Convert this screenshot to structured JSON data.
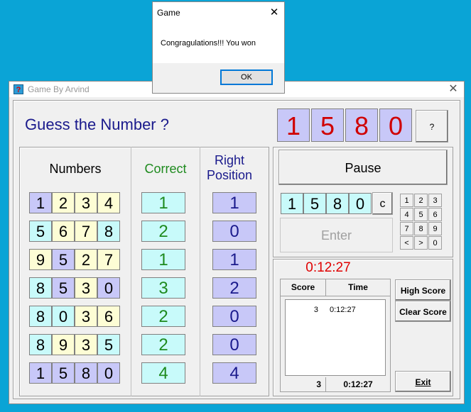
{
  "window": {
    "title": "Game By Arvind",
    "icon_text": "?",
    "close": "✕"
  },
  "game": {
    "heading": "Guess the Number ?",
    "answer_digits": [
      "1",
      "5",
      "8",
      "0"
    ],
    "help_label": "?",
    "columns": {
      "numbers": "Numbers",
      "correct": "Correct",
      "right_position_line1": "Right",
      "right_position_line2": "Position"
    },
    "guesses": [
      {
        "digits": [
          "1",
          "2",
          "3",
          "4"
        ],
        "colors": [
          "purple",
          "yellow",
          "yellow",
          "yellow"
        ],
        "correct": "1",
        "position": "1"
      },
      {
        "digits": [
          "5",
          "6",
          "7",
          "8"
        ],
        "colors": [
          "cyan",
          "yellow",
          "yellow",
          "cyan"
        ],
        "correct": "2",
        "position": "0"
      },
      {
        "digits": [
          "9",
          "5",
          "2",
          "7"
        ],
        "colors": [
          "yellow",
          "purple",
          "yellow",
          "yellow"
        ],
        "correct": "1",
        "position": "1"
      },
      {
        "digits": [
          "8",
          "5",
          "3",
          "0"
        ],
        "colors": [
          "cyan",
          "purple",
          "yellow",
          "purple"
        ],
        "correct": "3",
        "position": "2"
      },
      {
        "digits": [
          "8",
          "0",
          "3",
          "6"
        ],
        "colors": [
          "cyan",
          "cyan",
          "yellow",
          "yellow"
        ],
        "correct": "2",
        "position": "0"
      },
      {
        "digits": [
          "8",
          "9",
          "3",
          "5"
        ],
        "colors": [
          "cyan",
          "yellow",
          "yellow",
          "cyan"
        ],
        "correct": "2",
        "position": "0"
      },
      {
        "digits": [
          "1",
          "5",
          "8",
          "0"
        ],
        "colors": [
          "purple",
          "purple",
          "purple",
          "purple"
        ],
        "correct": "4",
        "position": "4"
      }
    ],
    "pause_label": "Pause",
    "input_digits": [
      "1",
      "5",
      "8",
      "0"
    ],
    "clear_label": "c",
    "keypad": [
      "1",
      "2",
      "3",
      "4",
      "5",
      "6",
      "7",
      "8",
      "9",
      "<",
      ">",
      "0"
    ],
    "enter_label": "Enter",
    "timer": "0:12:27",
    "scores": {
      "col_score": "Score",
      "col_time": "Time",
      "rows": [
        {
          "score": "3",
          "time": "0:12:27"
        }
      ],
      "footer_score": "3",
      "footer_time": "0:12:27"
    },
    "high_score_label": "High Score",
    "clear_score_label": "Clear Score",
    "exit_label": "Exit"
  },
  "dialog": {
    "title": "Game",
    "close": "✕",
    "message": "Congragulations!!! You won",
    "ok_label": "OK"
  },
  "colors": {
    "heading": "#1a1a8c",
    "answer": "#d00000",
    "correct": "#1e8a1e",
    "position": "#1a1a8c",
    "timer": "#e00000"
  }
}
